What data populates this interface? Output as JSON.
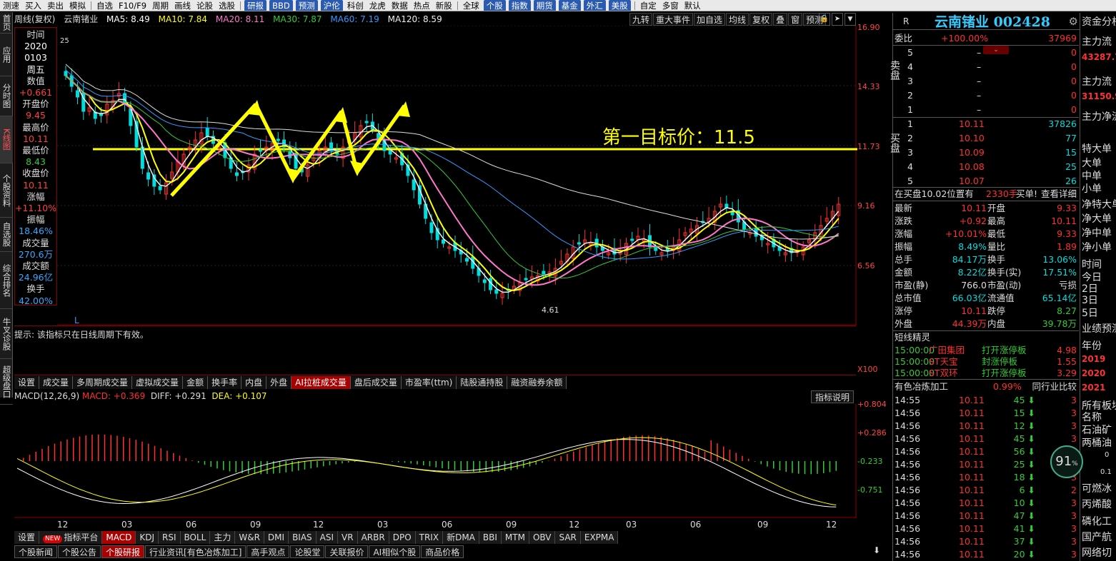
{
  "topmenu": [
    "测速",
    "买入",
    "卖出",
    "模拟",
    "自选",
    "F10/F9",
    "周期",
    "画线",
    "论股",
    "选股",
    "研报",
    "BBD",
    "预测",
    "沪伦",
    "科创",
    "龙虎",
    "数据",
    "热点",
    "新股",
    "全球",
    "个股",
    "指数",
    "期货",
    "基金",
    "外汇",
    "美股",
    "自定",
    "多窗",
    "默认"
  ],
  "lefttabs": [
    "首页",
    "应用",
    "分时图",
    "K线图",
    "个股资料",
    "自选股",
    "综合排名",
    "牛叉诊股",
    "超级盘口"
  ],
  "chart_header": {
    "period": "周线(复权)",
    "stock": "云南锗业",
    "ma5": "MA5: 8.49",
    "ma10": "MA10: 7.84",
    "ma20": "MA20: 8.11",
    "ma30": "MA30: 7.87",
    "ma60": "MA60: 7.19",
    "ma120": "MA120: 8.59"
  },
  "chart_tools": [
    "九转",
    "重大事件",
    "加自选",
    "均线",
    "复权",
    "叠",
    "窗",
    "预测"
  ],
  "infobox": {
    "time_label": "时间",
    "year": "2020",
    "date": "0103",
    "weekday": "周五",
    "value_label": "数值",
    "value": "+0.661",
    "open_label": "开盘价",
    "open": "9.45",
    "high_label": "最高价",
    "high": "10.11",
    "low_label": "最低价",
    "low": "8.43",
    "close_label": "收盘价",
    "close": "10.11",
    "chg_label": "涨幅",
    "chg": "+11.10%",
    "amp_label": "振幅",
    "amp": "18.46%",
    "vol_label": "成交量",
    "vol": "270.6万",
    "amt_label": "成交额",
    "amt": "24.96亿",
    "turn_label": "换手",
    "turn": "42.00%"
  },
  "yaxis": {
    "p1": "16.90",
    "p2": "14.33",
    "p3": "11.73",
    "p4": "9.16",
    "p5": "6.56",
    "p6": "X100"
  },
  "annotation": {
    "target": "第一目标价：11.5",
    "low_mark": "4.61",
    "high_mark": "25",
    "l_mark": "L"
  },
  "hint": "提示: 该指标只在日线周期下有效。",
  "indicator_tabs": [
    "设置",
    "成交量",
    "多周期成交量",
    "虚拟成交量",
    "金额",
    "换手率",
    "内盘",
    "外盘",
    "AI拉桩成交量",
    "盘后成交量",
    "市盈率(ttm)",
    "陆股通持股",
    "融资融券余额"
  ],
  "macd": {
    "name": "MACD(12,26,9)",
    "macd": "MACD: +0.369",
    "diff": "DIFF: +0.291",
    "dea": "DEA: +0.107",
    "explain": "指标说明",
    "y1": "+0.804",
    "y2": "+0.286",
    "y3": "-0.233",
    "y4": "-0.751"
  },
  "xaxis": [
    "12",
    "03",
    "06",
    "09",
    "12",
    "03",
    "06",
    "09",
    "12",
    "03",
    "06",
    "09",
    "12"
  ],
  "bottom_tabs": [
    "设置",
    "指标平台",
    "MACD",
    "KDJ",
    "RSI",
    "BOLL",
    "主力",
    "W&R",
    "DMI",
    "BIAS",
    "ASI",
    "VR",
    "ARBR",
    "DPO",
    "TRIX",
    "新DMA",
    "BBI",
    "MTM",
    "OBV",
    "SAR",
    "EXPMA"
  ],
  "new_badge": "NEW",
  "news_tabs": [
    "个股新闻",
    "个股公告",
    "个股研报",
    "行业资讯[有色冶炼加工]",
    "高手观点",
    "论股堂",
    "关联报价",
    "AI相似个股",
    "商品价格"
  ],
  "quote": {
    "title": "云南锗业 002428",
    "r": "R",
    "weibi_label": "委比",
    "weibi": "+100.00%",
    "weicha": "37969",
    "sell_label": "卖盘",
    "buy_label": "买盘",
    "sells": [
      [
        "5",
        "–",
        "0"
      ],
      [
        "4",
        "–",
        "0"
      ],
      [
        "3",
        "–",
        "0"
      ],
      [
        "2",
        "–",
        "0"
      ],
      [
        "1",
        "–",
        "0"
      ]
    ],
    "buys": [
      [
        "1",
        "10.11",
        "37826"
      ],
      [
        "2",
        "10.10",
        "77"
      ],
      [
        "3",
        "10.09",
        "15"
      ],
      [
        "4",
        "10.08",
        "25"
      ],
      [
        "5",
        "10.07",
        "26"
      ]
    ],
    "buy_queue": "在买盘10.02位置有",
    "buy_qty": "2330手",
    "buy_suffix": "买单!",
    "detail": "查看详细",
    "stats": [
      [
        "最新",
        "10.11",
        "开盘",
        "9.33"
      ],
      [
        "涨跌",
        "+0.92",
        "最高",
        "10.11"
      ],
      [
        "涨幅",
        "+10.01%",
        "最低",
        "9.33"
      ],
      [
        "振幅",
        "8.49%",
        "量比",
        "1.89"
      ],
      [
        "总手",
        "84.17万",
        "换手",
        "13.06%"
      ],
      [
        "金额",
        "8.22亿",
        "换手(实)",
        "17.51%"
      ],
      [
        "市盈(静)",
        "766.0",
        "市盈(动)",
        "亏损"
      ],
      [
        "总市值",
        "66.03亿",
        "流通值",
        "65.14亿"
      ],
      [
        "涨停",
        "10.11",
        "跌停",
        "8.27"
      ],
      [
        "外盘",
        "44.39万",
        "内盘",
        "39.78万"
      ]
    ],
    "elf_title": "短线精灵",
    "elf": [
      [
        "15:00:00",
        "广田集团",
        "打开涨停板",
        "4.98"
      ],
      [
        "15:00:00",
        "ST天宝",
        "封涨停板",
        "1.55"
      ],
      [
        "15:00:00",
        "ST双环",
        "打开涨停板",
        "3.29"
      ]
    ],
    "industry": "有色冶炼加工",
    "industry_pct": "0.99%",
    "peer": "同行业比较",
    "ticks": [
      [
        "14:55",
        "10.11",
        "45"
      ],
      [
        "14:56",
        "10.11",
        "15"
      ],
      [
        "14:56",
        "10.11",
        "12"
      ],
      [
        "14:56",
        "10.11",
        "45"
      ],
      [
        "14:56",
        "10.11",
        "56"
      ],
      [
        "14:56",
        "10.11",
        "25"
      ],
      [
        "14:56",
        "10.11",
        "18"
      ],
      [
        "14:56",
        "10.11",
        "6"
      ],
      [
        "14:56",
        "10.11",
        "10"
      ],
      [
        "14:56",
        "10.11",
        "47"
      ],
      [
        "14:56",
        "10.11",
        "41"
      ],
      [
        "14:56",
        "10.11",
        "37"
      ],
      [
        "14:56",
        "10.11",
        "20"
      ]
    ],
    "tick_tail": [
      "3",
      "3",
      "3",
      "3",
      "3",
      "3",
      "3",
      "2",
      "3",
      "3",
      "3",
      "3",
      "3"
    ]
  },
  "farright": [
    "资金分析",
    "主力流",
    "43287.7",
    "主力流",
    "31150.9",
    "主力净流",
    "特大单",
    "大单",
    "中单",
    "小单",
    "净特大单",
    "净大单",
    "净中单",
    "净小单",
    "时间",
    "今日",
    "2日",
    "3日",
    "5日",
    "业绩预测",
    "年份",
    "2019",
    "2020",
    "2021",
    "所有板块",
    "名称",
    "石油矿",
    "两桶油",
    "可燃冰",
    "丙烯酸",
    "磷化工",
    "国产航",
    "网络切"
  ],
  "gauge": "91",
  "gauge_unit": "%",
  "gauge_a": "0",
  "gauge_b": "0.1"
}
